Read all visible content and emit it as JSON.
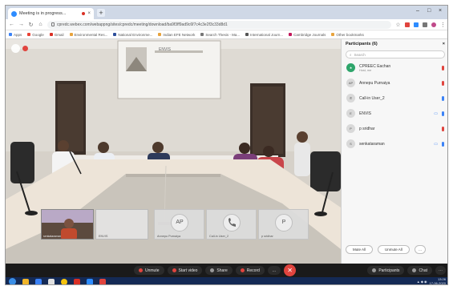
{
  "browser": {
    "tab_title": "Meeting is in progress...",
    "new_tab_symbol": "+",
    "url": "cpredc.webex.com/webappng/sites/cpredc/meeting/download/ba9f3ff9ad9c6f7c4c3e2f3c33d8d1",
    "bookmarks": [
      "Apps",
      "Google",
      "Gmail",
      "Environmental Res...",
      "National Environme...",
      "Indian EFE Network",
      "Search Thesis - Ma...",
      "International Journ...",
      "Cambridge Journals",
      "Other bookmarks"
    ]
  },
  "stage": {
    "slide_text": "ENVIS"
  },
  "tiles": [
    {
      "name": "senkataraman",
      "type": "video"
    },
    {
      "name": "ENVIS",
      "type": "blank"
    },
    {
      "name": "Annepu Purnaiya",
      "initials": "AP",
      "type": "avatar"
    },
    {
      "name": "Call-in User_2",
      "icon": "phone-icon",
      "type": "phone"
    },
    {
      "name": "p sridhar",
      "initials": "P",
      "type": "avatar"
    }
  ],
  "participants_panel": {
    "title": "Participants (6)",
    "search_placeholder": "Search",
    "items": [
      {
        "name": "CPREEC Eachan",
        "sub": "Host, me",
        "avatar_icon": "presenter-icon",
        "mic": "red",
        "video": false
      },
      {
        "name": "Annepu Purnaiya",
        "avatar_initials": "AP",
        "mic": "red",
        "video": false
      },
      {
        "name": "Call-in User_2",
        "avatar_icon": "phone-icon",
        "mic": "blue",
        "video": false
      },
      {
        "name": "ENVIS",
        "avatar_initials": "E",
        "mic": "blue",
        "video": true
      },
      {
        "name": "p sridhar",
        "avatar_initials": "P",
        "mic": "red",
        "video": false
      },
      {
        "name": "senkataraman",
        "avatar_initials": "S",
        "mic": "blue",
        "video": true
      }
    ],
    "mute_all": "Mute All",
    "unmute_all": "Unmute All"
  },
  "controls": {
    "unmute": "Unmute",
    "start_video": "Start video",
    "share": "Share",
    "record": "Record",
    "more": "...",
    "end_symbol": "✕",
    "participants": "Participants",
    "chat": "Chat"
  },
  "taskbar": {
    "time": "13:26",
    "date": "17-06-2020"
  },
  "colors": {
    "accent": "#e0443e",
    "blue": "#3b82f6",
    "taskbar": "#142a55"
  }
}
